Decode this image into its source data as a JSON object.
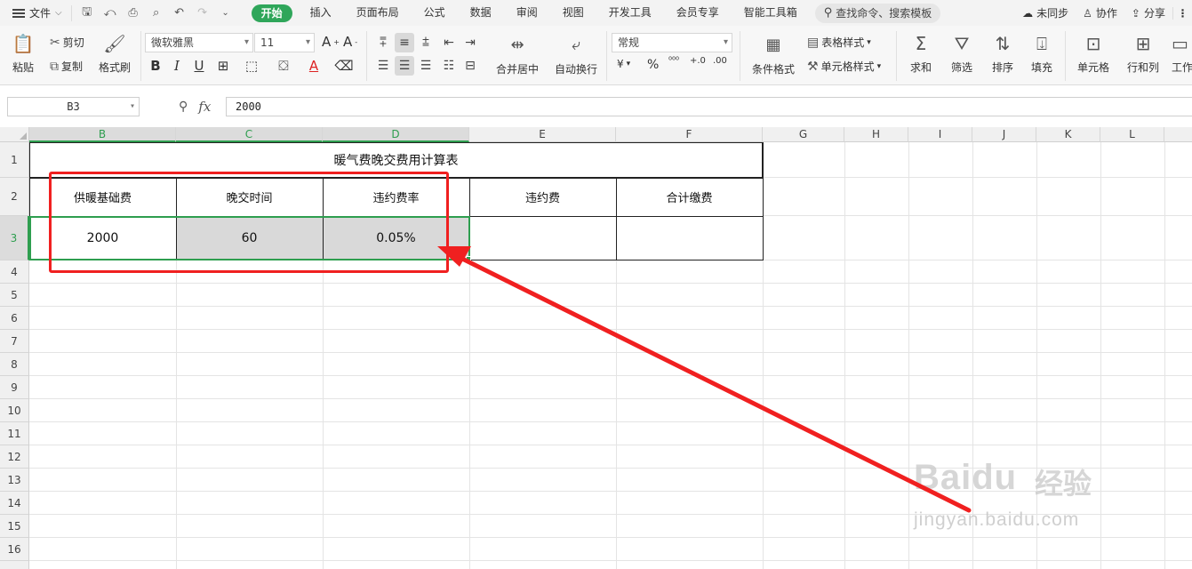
{
  "menubar": {
    "file_label": "文件",
    "tabs": [
      {
        "label": "开始"
      },
      {
        "label": "插入"
      },
      {
        "label": "页面布局"
      },
      {
        "label": "公式"
      },
      {
        "label": "数据"
      },
      {
        "label": "审阅"
      },
      {
        "label": "视图"
      },
      {
        "label": "开发工具"
      },
      {
        "label": "会员专享"
      },
      {
        "label": "智能工具箱"
      }
    ],
    "search_placeholder": "查找命令、搜索模板",
    "sync_label": "未同步",
    "collab_label": "协作",
    "share_label": "分享"
  },
  "ribbon": {
    "paste": "粘贴",
    "cut": "剪切",
    "copy": "复制",
    "format_painter": "格式刷",
    "font_name": "微软雅黑",
    "font_size": "11",
    "merge_center": "合并居中",
    "wrap_text": "自动换行",
    "number_format": "常规",
    "conditional_format": "条件格式",
    "table_style": "表格样式",
    "cell_style": "单元格样式",
    "sum": "求和",
    "filter": "筛选",
    "sort": "排序",
    "fill": "填充",
    "cell": "单元格",
    "row_col": "行和列",
    "worksheet": "工作"
  },
  "formula_bar": {
    "name_box": "B3",
    "formula": "2000"
  },
  "sheet": {
    "columns": [
      "B",
      "C",
      "D",
      "E",
      "F",
      "G",
      "H",
      "I",
      "J",
      "K",
      "L"
    ],
    "rows": [
      "1",
      "2",
      "3",
      "4",
      "5",
      "6",
      "7",
      "8",
      "9",
      "10",
      "11",
      "12",
      "13",
      "14",
      "15",
      "16"
    ],
    "title": "暖气费晚交费用计算表",
    "headers": [
      "供暖基础费",
      "晚交时间",
      "违约费率",
      "违约费",
      "合计缴费"
    ],
    "values": [
      "2000",
      "60",
      "0.05%",
      "",
      ""
    ]
  },
  "watermark": {
    "logo": "Baidu",
    "cn": "经验",
    "url": "jingyan.baidu.com"
  },
  "colors": {
    "accent_green": "#2fa65a",
    "selection_green": "#2e9e4f",
    "annotation_red": "#f02020"
  }
}
